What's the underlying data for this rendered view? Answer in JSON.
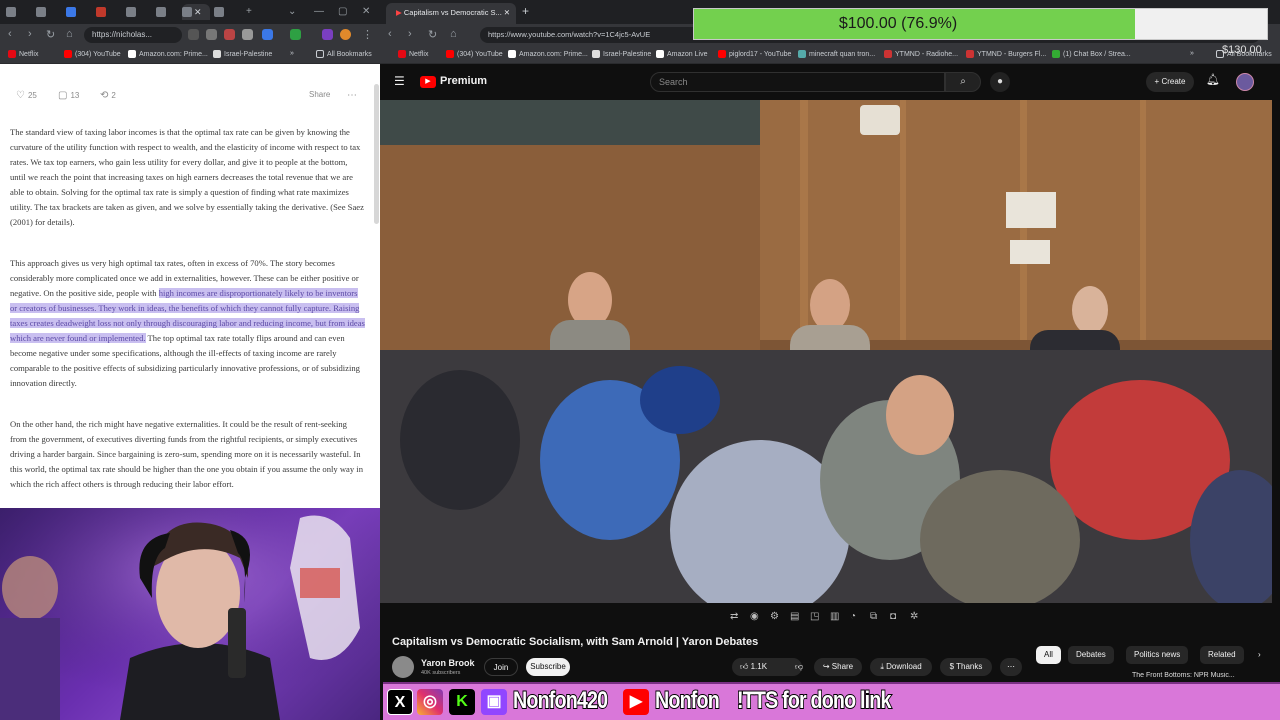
{
  "left_browser": {
    "url": "https://nicholas...",
    "bookmarks": [
      "Netflix",
      "(304) YouTube",
      "Amazon.com: Prime...",
      "Israel-Palestine",
      "All Bookmarks"
    ],
    "engagement": {
      "likes": "25",
      "comments": "13",
      "restacks": "2",
      "share": "Share"
    },
    "paragraphs": {
      "p1": "The standard view of taxing labor incomes is that the optimal tax rate can be given by knowing the curvature of the utility function with respect to wealth, and the elasticity of income with respect to tax rates. We tax top earners, who gain less utility for every dollar, and give it to people at the bottom, until we reach the point that increasing taxes on high earners decreases the total revenue that we are able to obtain. Solving for the optimal tax rate is simply a question of finding what rate maximizes utility. The tax brackets are taken as given, and we solve by essentially taking the derivative. (See Saez (2001) for details).",
      "p2_before": "This approach gives us very high optimal tax rates, often in excess of 70%. The story becomes considerably more complicated once we add in externalities, however. These can be either positive or negative. On the positive side, people with ",
      "p2_highlight": "high incomes are disproportionately likely to be inventors or creators of businesses. They work in ideas, the benefits of which they cannot fully capture. Raising taxes creates deadweight loss not only through discouraging labor and reducing income, but from ideas which are never found or implemented.",
      "p2_after": " The top optimal tax rate totally flips around and can even become negative under some specifications, although the ill-effects of taxing income are rarely comparable to the positive effects of subsidizing particularly innovative professions, or of subsidizing innovation directly.",
      "p3": "On the other hand, the rich might have negative externalities. It could be the result of rent-seeking from the government, of executives diverting funds from the rightful recipients, or simply executives driving a harder bargain. Since bargaining is zero-sum, spending more on it is necessarily wasteful. In this world, the optimal tax rate should be higher than the one you obtain if you assume the only way in which the rich affect others is through reducing their labor effort."
    }
  },
  "right_browser": {
    "tab_title": "Capitalism vs Democratic S...",
    "url": "https://www.youtube.com/watch?v=1C4jc5-AvUE",
    "bookmarks": [
      "Netflix",
      "(304) YouTube",
      "Amazon.com: Prime...",
      "Israel-Palestine",
      "Amazon Live",
      "piglord17 - YouTube",
      "minecraft quan tron...",
      "YTMND - Radiohe...",
      "YTMND - Burgers Fl...",
      "(1) Chat Box / Strea...",
      "All Bookmarks"
    ]
  },
  "youtube": {
    "logo_text": "Premium",
    "search_placeholder": "Search",
    "create_label": "Create",
    "video_title": "Capitalism vs Democratic Socialism, with Sam Arnold | Yaron Debates",
    "channel_name": "Yaron Brook",
    "subscribers": "40K subscribers",
    "join_label": "Join",
    "subscribe_label": "Subscribe",
    "likes": "1.1K",
    "share_label": "Share",
    "download_label": "Download",
    "thanks_label": "Thanks",
    "chips": [
      "All",
      "Debates",
      "Politics news",
      "Related"
    ],
    "next_video_title": "The Front Bottoms: NPR Music..."
  },
  "donation": {
    "text": "$100.00 (76.9%)",
    "progress": 0.769,
    "goal": "$130.00"
  },
  "social": {
    "handle1": "Nonfon420",
    "handle2": "Nonfon",
    "tts": "!TTS for dono link"
  },
  "colors": {
    "yt_red": "#ff0000",
    "donation_green": "#73d04e",
    "highlight": "#c9bff0",
    "overlay_pink": "#d977d9"
  }
}
